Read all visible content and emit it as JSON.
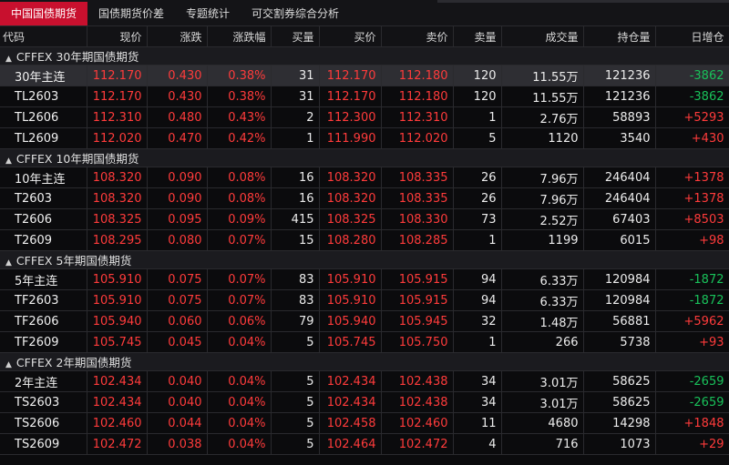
{
  "tabs": [
    {
      "label": "中国国债期货",
      "active": true
    },
    {
      "label": "国债期货价差",
      "active": false
    },
    {
      "label": "专题统计",
      "active": false
    },
    {
      "label": "可交割券综合分析",
      "active": false
    }
  ],
  "columns": [
    "代码",
    "现价",
    "涨跌",
    "涨跌幅",
    "买量",
    "买价",
    "卖价",
    "卖量",
    "成交量",
    "持仓量",
    "日增仓"
  ],
  "groups": [
    {
      "title": "CFFEX 30年期国债期货",
      "rows": [
        {
          "code": "30年主连",
          "price": "112.170",
          "change": "0.430",
          "pct": "0.38%",
          "bid_vol": "31",
          "bid": "112.170",
          "ask": "112.180",
          "ask_vol": "120",
          "volume": "11.55万",
          "oi": "121236",
          "oi_chg": "-3862",
          "selected": true
        },
        {
          "code": "TL2603",
          "price": "112.170",
          "change": "0.430",
          "pct": "0.38%",
          "bid_vol": "31",
          "bid": "112.170",
          "ask": "112.180",
          "ask_vol": "120",
          "volume": "11.55万",
          "oi": "121236",
          "oi_chg": "-3862"
        },
        {
          "code": "TL2606",
          "price": "112.310",
          "change": "0.480",
          "pct": "0.43%",
          "bid_vol": "2",
          "bid": "112.300",
          "ask": "112.310",
          "ask_vol": "1",
          "volume": "2.76万",
          "oi": "58893",
          "oi_chg": "+5293"
        },
        {
          "code": "TL2609",
          "price": "112.020",
          "change": "0.470",
          "pct": "0.42%",
          "bid_vol": "1",
          "bid": "111.990",
          "ask": "112.020",
          "ask_vol": "5",
          "volume": "1120",
          "oi": "3540",
          "oi_chg": "+430"
        }
      ]
    },
    {
      "title": "CFFEX 10年期国债期货",
      "rows": [
        {
          "code": "10年主连",
          "price": "108.320",
          "change": "0.090",
          "pct": "0.08%",
          "bid_vol": "16",
          "bid": "108.320",
          "ask": "108.335",
          "ask_vol": "26",
          "volume": "7.96万",
          "oi": "246404",
          "oi_chg": "+1378"
        },
        {
          "code": "T2603",
          "price": "108.320",
          "change": "0.090",
          "pct": "0.08%",
          "bid_vol": "16",
          "bid": "108.320",
          "ask": "108.335",
          "ask_vol": "26",
          "volume": "7.96万",
          "oi": "246404",
          "oi_chg": "+1378"
        },
        {
          "code": "T2606",
          "price": "108.325",
          "change": "0.095",
          "pct": "0.09%",
          "bid_vol": "415",
          "bid": "108.325",
          "ask": "108.330",
          "ask_vol": "73",
          "volume": "2.52万",
          "oi": "67403",
          "oi_chg": "+8503"
        },
        {
          "code": "T2609",
          "price": "108.295",
          "change": "0.080",
          "pct": "0.07%",
          "bid_vol": "15",
          "bid": "108.280",
          "ask": "108.285",
          "ask_vol": "1",
          "volume": "1199",
          "oi": "6015",
          "oi_chg": "+98"
        }
      ]
    },
    {
      "title": "CFFEX 5年期国债期货",
      "rows": [
        {
          "code": "5年主连",
          "price": "105.910",
          "change": "0.075",
          "pct": "0.07%",
          "bid_vol": "83",
          "bid": "105.910",
          "ask": "105.915",
          "ask_vol": "94",
          "volume": "6.33万",
          "oi": "120984",
          "oi_chg": "-1872"
        },
        {
          "code": "TF2603",
          "price": "105.910",
          "change": "0.075",
          "pct": "0.07%",
          "bid_vol": "83",
          "bid": "105.910",
          "ask": "105.915",
          "ask_vol": "94",
          "volume": "6.33万",
          "oi": "120984",
          "oi_chg": "-1872"
        },
        {
          "code": "TF2606",
          "price": "105.940",
          "change": "0.060",
          "pct": "0.06%",
          "bid_vol": "79",
          "bid": "105.940",
          "ask": "105.945",
          "ask_vol": "32",
          "volume": "1.48万",
          "oi": "56881",
          "oi_chg": "+5962"
        },
        {
          "code": "TF2609",
          "price": "105.745",
          "change": "0.045",
          "pct": "0.04%",
          "bid_vol": "5",
          "bid": "105.745",
          "ask": "105.750",
          "ask_vol": "1",
          "volume": "266",
          "oi": "5738",
          "oi_chg": "+93"
        }
      ]
    },
    {
      "title": "CFFEX 2年期国债期货",
      "rows": [
        {
          "code": "2年主连",
          "price": "102.434",
          "change": "0.040",
          "pct": "0.04%",
          "bid_vol": "5",
          "bid": "102.434",
          "ask": "102.438",
          "ask_vol": "34",
          "volume": "3.01万",
          "oi": "58625",
          "oi_chg": "-2659"
        },
        {
          "code": "TS2603",
          "price": "102.434",
          "change": "0.040",
          "pct": "0.04%",
          "bid_vol": "5",
          "bid": "102.434",
          "ask": "102.438",
          "ask_vol": "34",
          "volume": "3.01万",
          "oi": "58625",
          "oi_chg": "-2659"
        },
        {
          "code": "TS2606",
          "price": "102.460",
          "change": "0.044",
          "pct": "0.04%",
          "bid_vol": "5",
          "bid": "102.458",
          "ask": "102.460",
          "ask_vol": "11",
          "volume": "4680",
          "oi": "14298",
          "oi_chg": "+1848"
        },
        {
          "code": "TS2609",
          "price": "102.472",
          "change": "0.038",
          "pct": "0.04%",
          "bid_vol": "5",
          "bid": "102.464",
          "ask": "102.472",
          "ask_vol": "4",
          "volume": "716",
          "oi": "1073",
          "oi_chg": "+29"
        }
      ]
    }
  ],
  "icons": {
    "group_caret": "caret-up-icon"
  },
  "colors": {
    "up": "#ff3b3b",
    "down": "#19c15a",
    "tab_active": "#c8102e"
  }
}
